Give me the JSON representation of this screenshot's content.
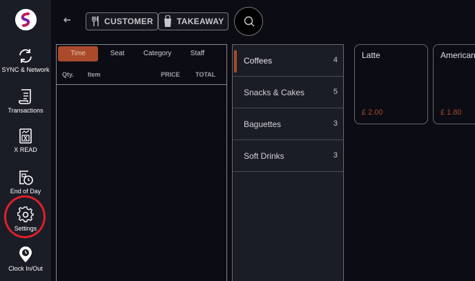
{
  "sidebar": {
    "items": [
      {
        "label": "SYNC & Network",
        "icon": "sync-icon"
      },
      {
        "label": "Transactions",
        "icon": "receipt-icon"
      },
      {
        "label": "X READ",
        "icon": "report-icon"
      },
      {
        "label": "End of Day",
        "icon": "end-of-day-icon"
      },
      {
        "label": "Settings",
        "icon": "gear-icon"
      },
      {
        "label": "Clock In/Out",
        "icon": "clock-pin-icon"
      }
    ],
    "highlight_color": "#e0202a"
  },
  "topbar": {
    "customer_label": "CUSTOMER",
    "takeaway_label": "TAKEAWAY"
  },
  "order": {
    "tabs": [
      "Time",
      "Seat",
      "Category",
      "Staff"
    ],
    "active_tab": "Time",
    "columns": {
      "qty": "Qty.",
      "item": "Item",
      "price": "PRICE",
      "total": "TOTAL"
    }
  },
  "categories": [
    {
      "name": "Coffees",
      "count": "4"
    },
    {
      "name": "Snacks & Cakes",
      "count": "5"
    },
    {
      "name": "Baguettes",
      "count": "3"
    },
    {
      "name": "Soft Drinks",
      "count": "3"
    }
  ],
  "products": [
    {
      "name": "Latte",
      "price": "£ 2.00"
    },
    {
      "name": "Americano",
      "price": "£ 1.80"
    }
  ],
  "colors": {
    "accent": "#a94a2a",
    "background": "#0c0c14",
    "sidebar": "#1a1d26"
  }
}
